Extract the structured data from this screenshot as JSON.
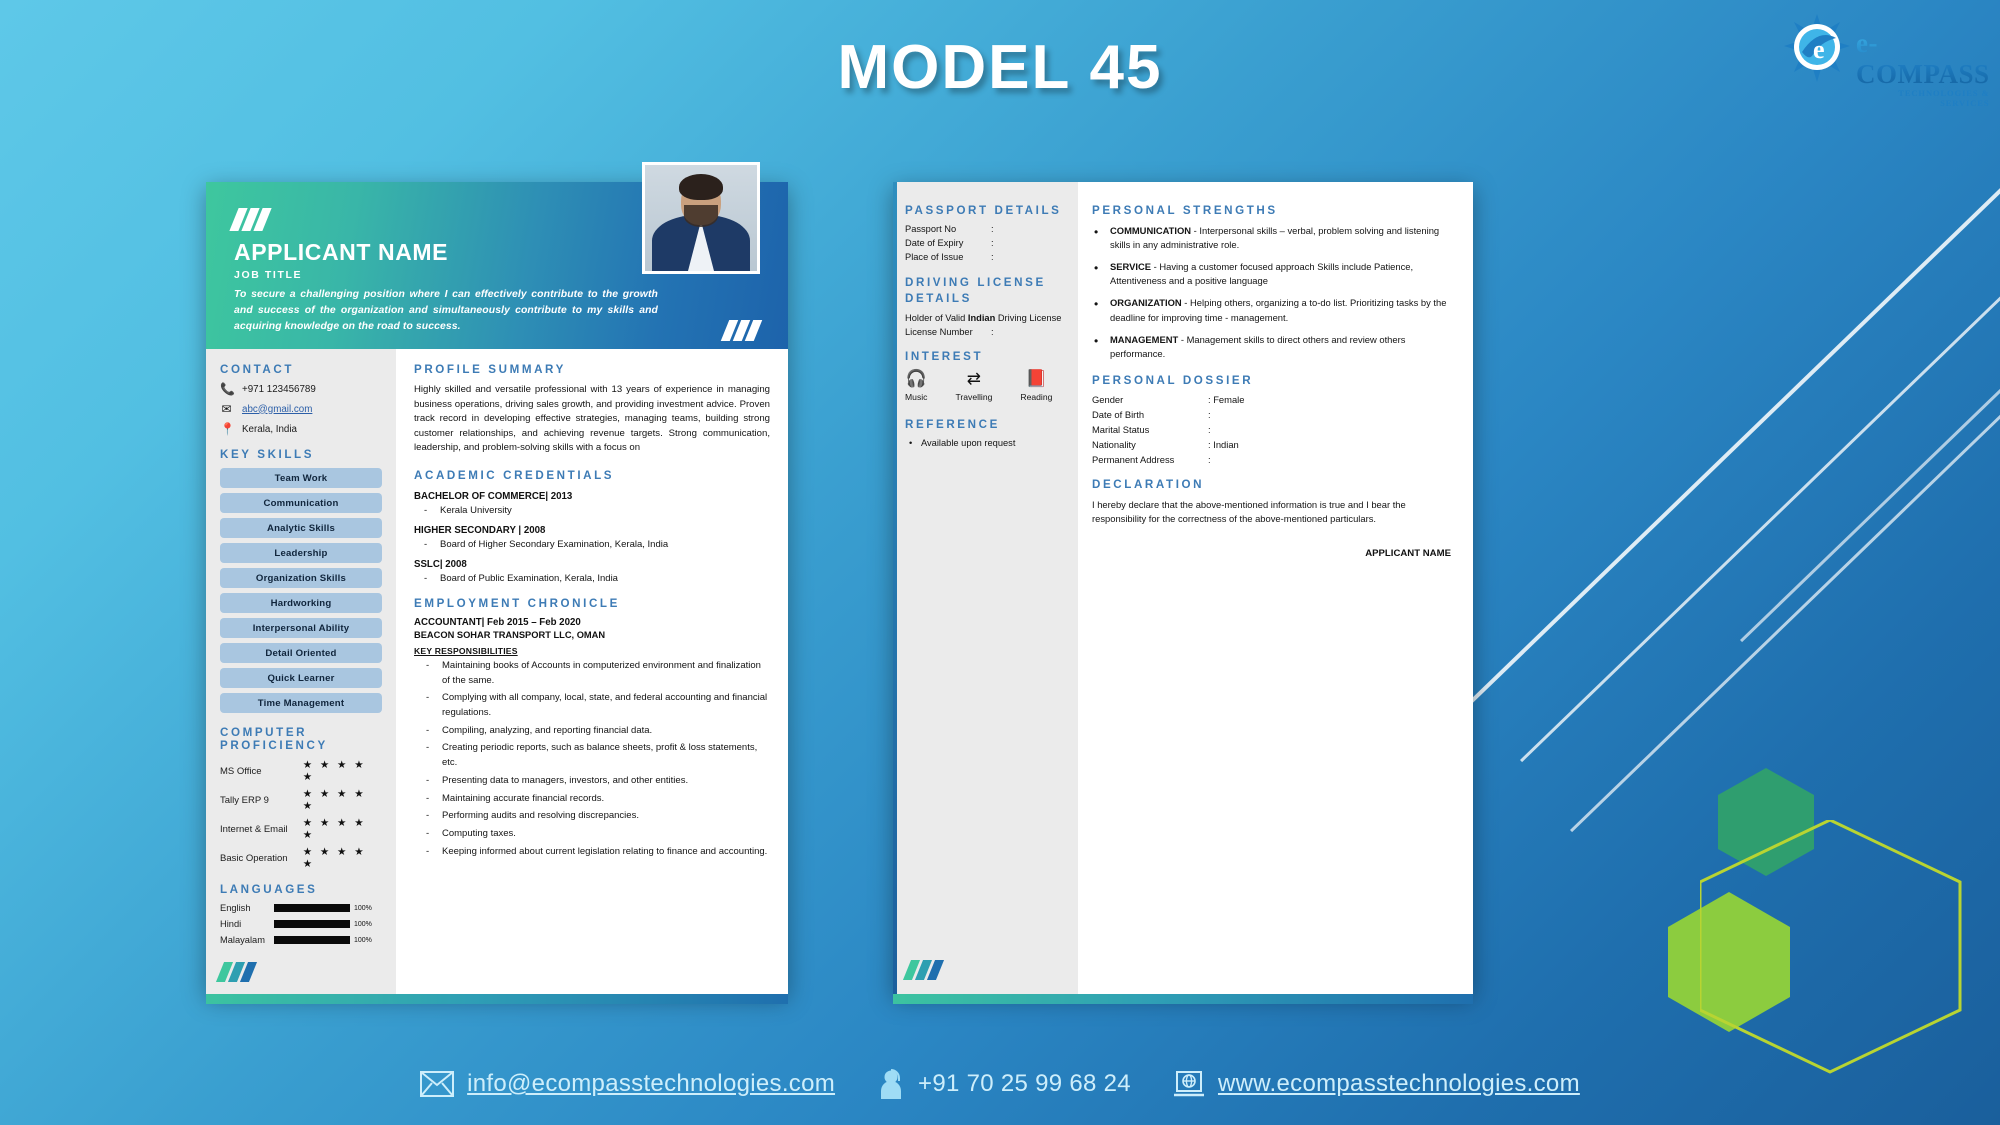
{
  "header": {
    "title": "MODEL 45",
    "logo": {
      "name": "e-COMPASS",
      "tagline": "TECHNOLOGIES & SERVICES",
      "icon": "compass-logo-icon"
    }
  },
  "colors": {
    "background_top": "#5ec8e8",
    "background_bottom": "#1a5f9c",
    "resume_header_green": "#3ec79e",
    "resume_header_blue": "#1d63ab",
    "section_heading_blue": "#3d7bb5",
    "skill_pill_blue": "#a9c6e0",
    "sidebar_grey": "#ebebeb",
    "job_role_orange": "#b8651b",
    "hex_green": "#2f9e6f",
    "hex_lime": "#8ccc3f",
    "footer_text": "#cdeefb"
  },
  "page1": {
    "applicant_name": "APPLICANT NAME",
    "job_title": "JOB TITLE",
    "objective": "To secure a challenging position where I can effectively contribute to the growth and success of the organization and simultaneously contribute to my skills and acquiring knowledge on the road to success.",
    "photo_alt": "applicant-photo",
    "contact": {
      "heading": "CONTACT",
      "items": [
        {
          "icon": "phone-icon",
          "value": "+971 123456789",
          "link": false
        },
        {
          "icon": "email-icon",
          "value": "abc@gmail.com",
          "link": true
        },
        {
          "icon": "location-pin-icon",
          "value": "Kerala, India",
          "link": false
        }
      ]
    },
    "key_skills": {
      "heading": "KEY SKILLS",
      "items": [
        "Team Work",
        "Communication",
        "Analytic Skills",
        "Leadership",
        "Organization Skills",
        "Hardworking",
        "Interpersonal Ability",
        "Detail Oriented",
        "Quick Learner",
        "Time Management"
      ]
    },
    "computer_proficiency": {
      "heading": "COMPUTER PROFICIENCY",
      "items": [
        {
          "name": "MS Office",
          "stars": "★ ★ ★ ★ ★"
        },
        {
          "name": "Tally ERP 9",
          "stars": "★ ★ ★ ★ ★"
        },
        {
          "name": "Internet & Email",
          "stars": "★ ★ ★ ★ ★"
        },
        {
          "name": "Basic Operation",
          "stars": "★ ★ ★ ★ ★"
        }
      ]
    },
    "languages": {
      "heading": "LANGUAGES",
      "items": [
        {
          "name": "English",
          "percent": "100%"
        },
        {
          "name": "Hindi",
          "percent": "100%"
        },
        {
          "name": "Malayalam",
          "percent": "100%"
        }
      ]
    },
    "profile_summary": {
      "heading": "PROFILE SUMMARY",
      "text": "Highly skilled and versatile professional with 13 years of experience in managing business operations, driving sales growth, and providing investment advice. Proven track record in developing effective strategies, managing teams, building strong customer relationships, and achieving revenue targets. Strong communication, leadership, and problem-solving skills with a focus on"
    },
    "academic_credentials": {
      "heading": "ACADEMIC CREDENTIALS",
      "items": [
        {
          "degree": "BACHELOR OF COMMERCE| 2013",
          "institute": "Kerala University"
        },
        {
          "degree": "HIGHER SECONDARY | 2008",
          "institute": "Board of Higher Secondary Examination, Kerala, India"
        },
        {
          "degree": "SSLC| 2008",
          "institute": "Board of Public Examination, Kerala, India"
        }
      ]
    },
    "employment": {
      "heading": "EMPLOYMENT CHRONICLE",
      "role": "ACCOUNTANT|",
      "dates": " Feb 2015 – Feb 2020",
      "organization": "BEACON SOHAR TRANSPORT LLC, OMAN",
      "responsibilities_heading": "KEY RESPONSIBILITIES",
      "responsibilities": [
        "Maintaining books of Accounts in computerized environment and finalization of the same.",
        "Complying with all company, local, state, and federal accounting and financial regulations.",
        "Compiling, analyzing, and reporting financial data.",
        "Creating periodic reports, such as balance sheets, profit & loss statements, etc.",
        "Presenting data to managers, investors, and other entities.",
        "Maintaining accurate financial records.",
        "Performing audits and resolving discrepancies.",
        "Computing taxes.",
        "Keeping informed about current legislation relating to finance and accounting."
      ]
    }
  },
  "page2": {
    "passport": {
      "heading": "PASSPORT DETAILS",
      "rows": [
        {
          "key": "Passport No",
          "value": ":"
        },
        {
          "key": "Date of Expiry",
          "value": ":"
        },
        {
          "key": "Place of Issue",
          "value": ":"
        }
      ]
    },
    "driving_license": {
      "heading": "DRIVING LICENSE DETAILS",
      "holder_prefix": "Holder of Valid ",
      "holder_bold": "Indian",
      "holder_suffix": " Driving License",
      "number_key": "License Number",
      "number_value": ":"
    },
    "interest": {
      "heading": "INTEREST",
      "items": [
        {
          "icon": "headphones-icon",
          "glyph": "Ἲ7",
          "label": "Music"
        },
        {
          "icon": "exchange-arrows-icon",
          "glyph": "⇄",
          "label": "Travelling"
        },
        {
          "icon": "book-icon",
          "glyph": "Ὅ5",
          "label": "Reading"
        }
      ]
    },
    "reference": {
      "heading": "REFERENCE",
      "items": [
        "Available upon request"
      ]
    },
    "personal_strengths": {
      "heading": "PERSONAL STRENGTHS",
      "items": [
        {
          "title": "COMMUNICATION",
          "text": " - Interpersonal skills – verbal, problem solving and listening skills in any administrative role."
        },
        {
          "title": "SERVICE",
          "text": " - Having a customer focused approach Skills include Patience, Attentiveness and a positive language"
        },
        {
          "title": "ORGANIZATION",
          "text": " - Helping others, organizing a to-do list. Prioritizing tasks by the deadline for improving time - management."
        },
        {
          "title": "MANAGEMENT",
          "text": " - Management skills to direct others and review others performance."
        }
      ]
    },
    "personal_dossier": {
      "heading": "PERSONAL DOSSIER",
      "rows": [
        {
          "key": "Gender",
          "value": ": Female"
        },
        {
          "key": "Date of Birth",
          "value": ":"
        },
        {
          "key": "Marital Status",
          "value": ":"
        },
        {
          "key": "Nationality",
          "value": ": Indian"
        },
        {
          "key": "Permanent Address",
          "value": ":"
        }
      ]
    },
    "declaration": {
      "heading": "DECLARATION",
      "text": "I hereby declare that the above-mentioned information is true and I bear the responsibility for the correctness of the above-mentioned particulars.",
      "signature": "APPLICANT NAME"
    }
  },
  "footer": {
    "email": {
      "icon": "envelope-icon",
      "value": "info@ecompasstechnologies.com"
    },
    "phone": {
      "icon": "support-agent-icon",
      "value": "+91 70 25 99 68 24"
    },
    "website": {
      "icon": "laptop-globe-icon",
      "value": "www.ecompasstechnologies.com"
    }
  }
}
